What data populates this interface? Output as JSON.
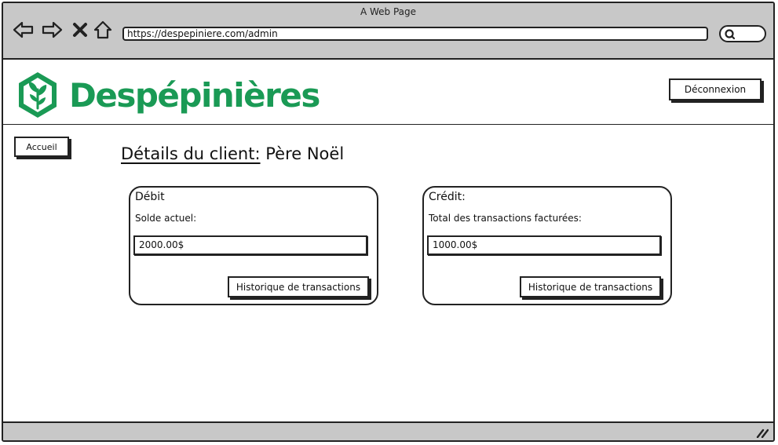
{
  "window": {
    "title": "A Web Page"
  },
  "browser": {
    "url": "https://despepiniere.com/admin"
  },
  "header": {
    "brand_name": "Despépinières",
    "logout_label": "Déconnexion",
    "brand_color": "#1a9a55"
  },
  "nav": {
    "home_label": "Accueil"
  },
  "page": {
    "heading_label": "Détails du client:",
    "client_name": "Père Noël"
  },
  "debit": {
    "title": "Débit",
    "balance_label": "Solde actuel:",
    "balance_value": "2000.00$",
    "history_button": "Historique de transactions"
  },
  "credit": {
    "title": "Crédit:",
    "total_label": "Total des transactions facturées:",
    "total_value": "1000.00$",
    "history_button": "Historique de transactions"
  }
}
